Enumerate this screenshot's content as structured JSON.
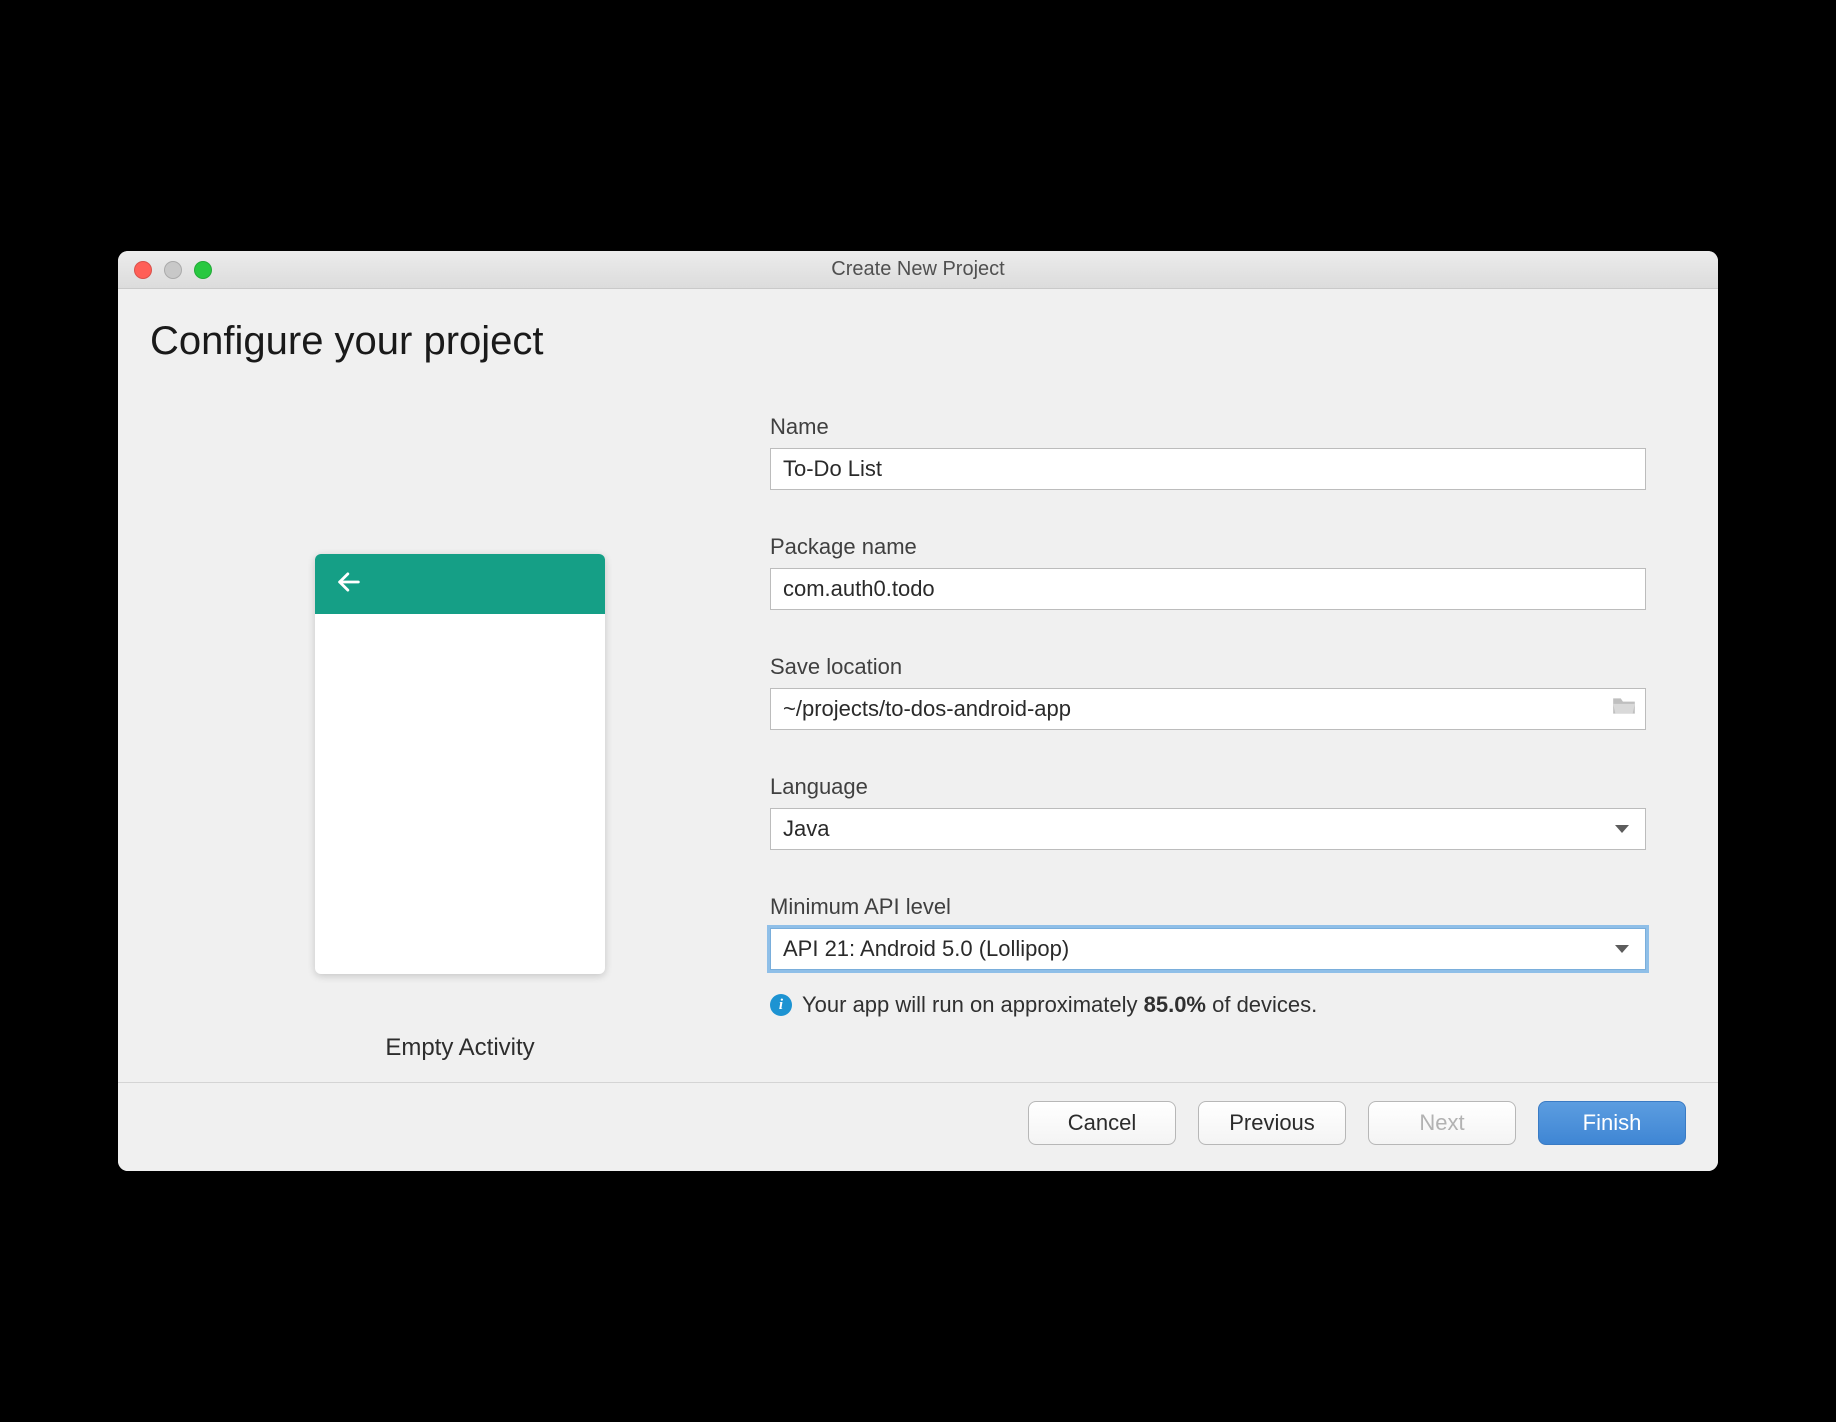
{
  "window": {
    "title": "Create New Project"
  },
  "page": {
    "heading": "Configure your project"
  },
  "preview": {
    "caption": "Empty Activity"
  },
  "form": {
    "name_label": "Name",
    "name_value": "To-Do List",
    "package_label": "Package name",
    "package_value": "com.auth0.todo",
    "location_label": "Save location",
    "location_value": "~/projects/to-dos-android-app",
    "language_label": "Language",
    "language_value": "Java",
    "api_label": "Minimum API level",
    "api_value": "API 21: Android 5.0 (Lollipop)",
    "info_prefix": "Your app will run on approximately ",
    "info_percent": "85.0%",
    "info_suffix": " of devices."
  },
  "footer": {
    "cancel": "Cancel",
    "previous": "Previous",
    "next": "Next",
    "finish": "Finish"
  }
}
